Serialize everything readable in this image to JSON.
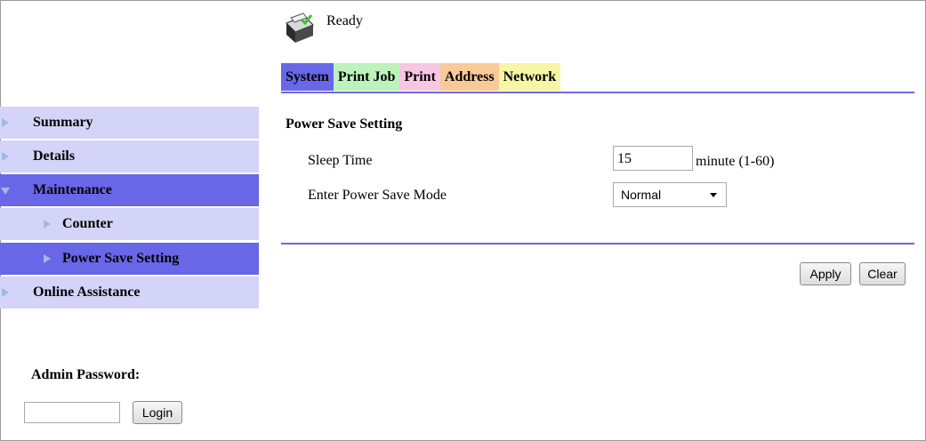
{
  "status": {
    "icon": "printer-ready-icon",
    "text": "Ready"
  },
  "tabs": [
    {
      "label": "System",
      "color": "#6767e8",
      "active": true
    },
    {
      "label": "Print Job",
      "color": "#bdf2bd",
      "active": false
    },
    {
      "label": "Print",
      "color": "#f6c6e2",
      "active": false
    },
    {
      "label": "Address",
      "color": "#f8ca98",
      "active": false
    },
    {
      "label": "Network",
      "color": "#f6f6a4",
      "active": false
    }
  ],
  "sidebar": {
    "items": [
      {
        "label": "Summary"
      },
      {
        "label": "Details"
      },
      {
        "label": "Maintenance",
        "expanded": true,
        "selected": true
      },
      {
        "label": "Counter",
        "child": true
      },
      {
        "label": "Power Save Setting",
        "child": true,
        "selected": true
      },
      {
        "label": "Online Assistance"
      }
    ],
    "admin": {
      "label": "Admin Password:",
      "password_value": "",
      "login_label": "Login"
    }
  },
  "main": {
    "section_title": "Power Save Setting",
    "sleep_time": {
      "label": "Sleep Time",
      "value": "15",
      "unit": "minute (1-60)"
    },
    "power_save_mode": {
      "label": "Enter Power Save Mode",
      "selected": "Normal"
    },
    "apply_label": "Apply",
    "clear_label": "Clear"
  },
  "colors": {
    "nav_light": "#d4d4f8",
    "nav_selected": "#6767e8",
    "divider": "#6b6bdb",
    "triangle": "#9fb8e6"
  }
}
